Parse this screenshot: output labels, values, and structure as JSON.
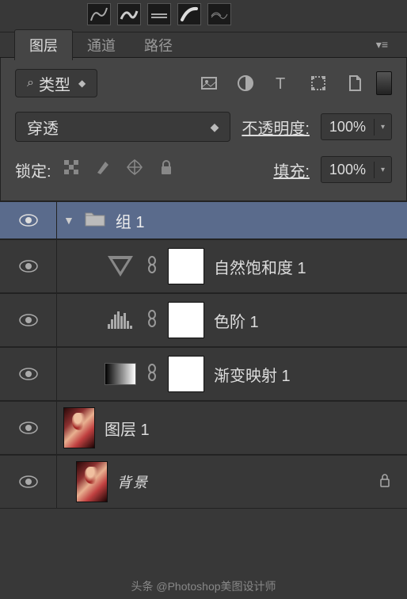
{
  "tabs": {
    "layers": "图层",
    "channels": "通道",
    "paths": "路径"
  },
  "filter": {
    "label": "类型"
  },
  "blend": {
    "mode": "穿透",
    "opacity_label": "不透明度:",
    "opacity_value": "100%",
    "fill_label": "填充:",
    "fill_value": "100%",
    "lock_label": "锁定:"
  },
  "layers": [
    {
      "name": "组 1",
      "kind": "group"
    },
    {
      "name": "自然饱和度 1",
      "kind": "vibrance"
    },
    {
      "name": "色阶 1",
      "kind": "levels"
    },
    {
      "name": "渐变映射 1",
      "kind": "gradient-map"
    },
    {
      "name": "图层 1",
      "kind": "image"
    },
    {
      "name": "背景",
      "kind": "background"
    }
  ],
  "footer": "头条 @Photoshop美图设计师"
}
